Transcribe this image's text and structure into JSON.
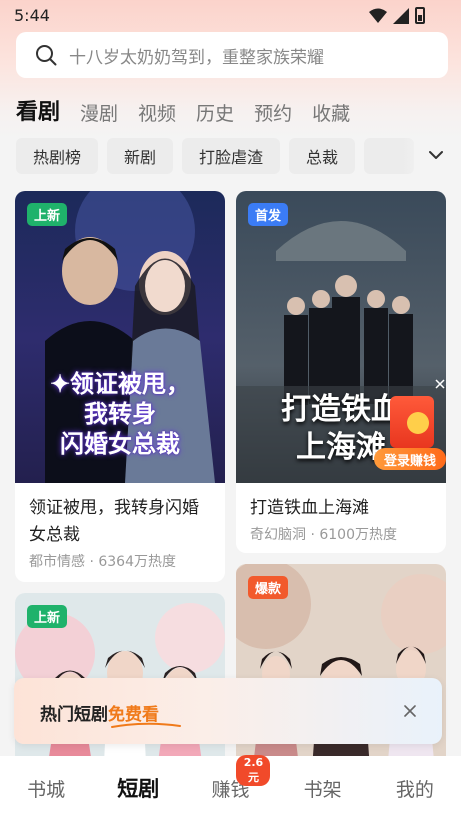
{
  "status_bar": {
    "time": "5:44"
  },
  "search": {
    "placeholder": "十八岁太奶奶驾到，重整家族荣耀"
  },
  "tabs": [
    {
      "label": "看剧",
      "active": true
    },
    {
      "label": "漫剧"
    },
    {
      "label": "视频"
    },
    {
      "label": "历史"
    },
    {
      "label": "预约"
    },
    {
      "label": "收藏"
    }
  ],
  "chips": [
    "热剧榜",
    "新剧",
    "打脸虐渣",
    "总裁"
  ],
  "cards": [
    {
      "badge": "上新",
      "poster_caption": [
        "✦领证被甩，",
        "我转身",
        "闪婚女总裁"
      ],
      "title": "领证被甩，我转身闪婚女总裁",
      "meta": "都市情感 · 6364万热度"
    },
    {
      "badge": "首发",
      "poster_caption": [
        "打造铁血",
        "上海滩"
      ],
      "title": "打造铁血上海滩",
      "meta": "奇幻脑洞 · 6100万热度"
    },
    {
      "badge": "上新"
    },
    {
      "badge": "爆款"
    }
  ],
  "redpacket": {
    "label": "登录赚钱"
  },
  "promo": {
    "text": "热门短剧",
    "accent": "免费看"
  },
  "bottom_nav": [
    {
      "label": "书城"
    },
    {
      "label": "短剧",
      "active": true
    },
    {
      "label": "赚钱",
      "badge": "2.6元"
    },
    {
      "label": "书架"
    },
    {
      "label": "我的"
    }
  ],
  "colors": {
    "accent": "#f07a1a",
    "badge_new": "#1fb26b",
    "badge_first": "#3b7cf5",
    "badge_hot": "#f25a2c"
  }
}
